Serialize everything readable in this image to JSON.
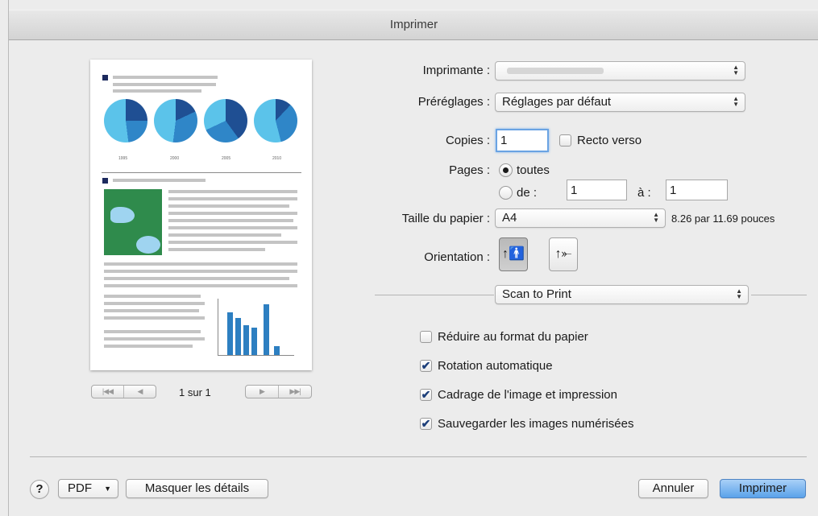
{
  "window": {
    "title": "Imprimer"
  },
  "preview": {
    "chart_years": [
      "1995",
      "2000",
      "2005",
      "2010"
    ],
    "page_indicator": "1 sur 1",
    "nav_first": "|◀◀",
    "nav_prev": "◀",
    "nav_next": "▶",
    "nav_last": "▶▶|"
  },
  "form": {
    "printer_label": "Imprimante :",
    "printer_value": "",
    "presets_label": "Préréglages :",
    "presets_value": "Réglages par défaut",
    "copies_label": "Copies :",
    "copies_value": "1",
    "duplex_label": "Recto verso",
    "duplex_checked": false,
    "pages_label": "Pages :",
    "pages_all_label": "toutes",
    "pages_range_label": "de :",
    "pages_from": "1",
    "pages_to_label": "à :",
    "pages_to": "1",
    "paper_label": "Taille du papier :",
    "paper_value": "A4",
    "paper_dims": "8.26 par 11.69 pouces",
    "orientation_label": "Orientation :",
    "app_section": "Scan to Print"
  },
  "options": [
    {
      "label": "Réduire au format du papier",
      "checked": false
    },
    {
      "label": "Rotation automatique",
      "checked": true
    },
    {
      "label": "Cadrage de l'image et impression",
      "checked": true
    },
    {
      "label": "Sauvegarder les images numérisées",
      "checked": true
    }
  ],
  "footer": {
    "help": "?",
    "pdf": "PDF",
    "hide_details": "Masquer les détails",
    "cancel": "Annuler",
    "print": "Imprimer"
  },
  "colors": {
    "accent": "#5aa2ea",
    "focus_ring": "#6aa3e3",
    "chart_blue": "#2d7fc1"
  }
}
